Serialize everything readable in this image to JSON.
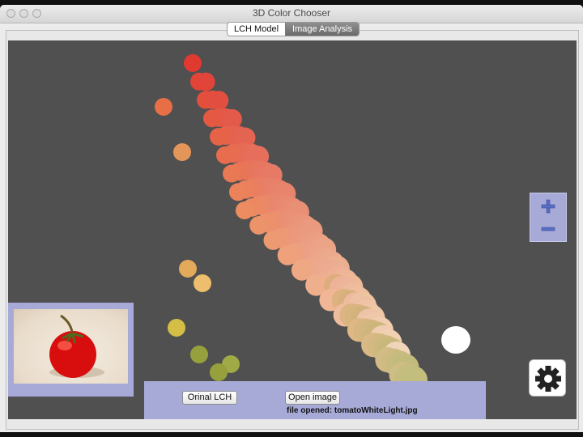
{
  "window": {
    "title": "3D Color Chooser"
  },
  "tabs": [
    {
      "label": "LCH Model",
      "selected": false
    },
    {
      "label": "Image Analysis",
      "selected": true
    }
  ],
  "zoom": {
    "zoom_in_icon": "plus-icon",
    "zoom_out_icon": "minus-icon"
  },
  "thumbnail": {
    "subject": "tomato"
  },
  "settings": {
    "icon": "gear-icon"
  },
  "bottom_bar": {
    "original_lch_button": "Orinal LCH",
    "open_image_button": "Open image",
    "status": "file opened: tomatoWhiteLight.jpg"
  },
  "colors": {
    "viewport_bg": "#505050",
    "accent_panel": "#a7aad7"
  }
}
